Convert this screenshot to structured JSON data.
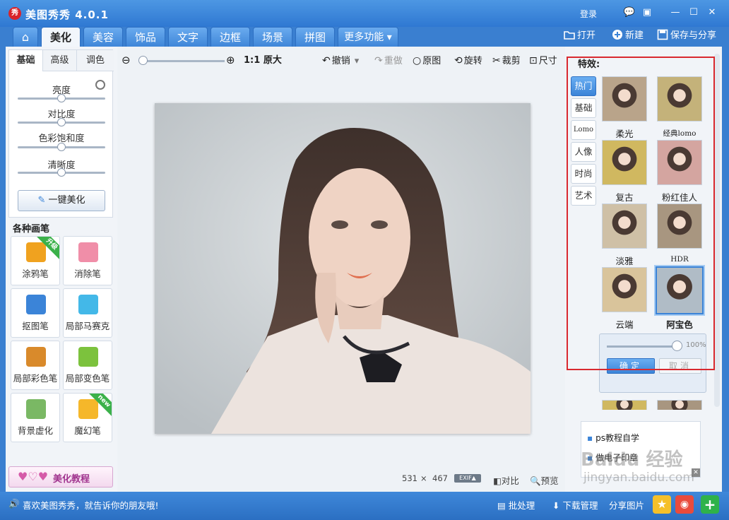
{
  "app": {
    "title": "美图秀秀 4.0.1",
    "logo_text": "秀",
    "login": "登录"
  },
  "window_controls": {
    "message": "💬",
    "skin": "▣",
    "minimize": "—",
    "maximize": "☐",
    "close": "✕"
  },
  "tabs": [
    {
      "label": "⌂"
    },
    {
      "label": "美化"
    },
    {
      "label": "美容"
    },
    {
      "label": "饰品"
    },
    {
      "label": "文字"
    },
    {
      "label": "边框"
    },
    {
      "label": "场景"
    },
    {
      "label": "拼图"
    },
    {
      "label": "更多功能 ▾"
    }
  ],
  "actions": {
    "open": "打开",
    "new": "新建",
    "save": "保存与分享"
  },
  "left": {
    "subtabs": [
      "基础",
      "高级",
      "调色"
    ],
    "sliders": [
      {
        "label": "亮度",
        "value": 0.5
      },
      {
        "label": "对比度",
        "value": 0.5
      },
      {
        "label": "色彩饱和度",
        "value": 0.5
      },
      {
        "label": "清晰度",
        "value": 0.5
      }
    ],
    "onekey": "一键美化",
    "brushes_title": "各种画笔",
    "brushes": [
      {
        "label": "涂鸦笔",
        "badge": "升级",
        "color": "#f0a21f"
      },
      {
        "label": "消除笔",
        "badge": "",
        "color": "#f08ea8"
      },
      {
        "label": "抠图笔",
        "badge": "",
        "color": "#3b84d8"
      },
      {
        "label": "局部马赛克",
        "badge": "",
        "color": "#43b8e8"
      },
      {
        "label": "局部彩色笔",
        "badge": "",
        "color": "#d98a2b"
      },
      {
        "label": "局部变色笔",
        "badge": "",
        "color": "#7cc23d"
      },
      {
        "label": "背景虚化",
        "badge": "",
        "color": "#7ab864"
      },
      {
        "label": "魔幻笔",
        "badge": "new",
        "color": "#f5b72a"
      }
    ],
    "tutorial": "美化教程"
  },
  "toolbar": {
    "zoom_value": 0.0,
    "actual_size": "1:1 原大",
    "undo": "撤销",
    "redo": "重做",
    "original": "原图",
    "rotate": "旋转",
    "crop": "裁剪",
    "size": "尺寸"
  },
  "status": {
    "width": "531",
    "times": "×",
    "height": "467",
    "exif": "EXIF▲",
    "compare": "对比",
    "preview": "预览"
  },
  "right": {
    "effects_label": "特效:",
    "categories": [
      "热门",
      "基础",
      "Lomo",
      "人像",
      "时尚",
      "艺术"
    ],
    "thumbs": [
      {
        "label": "柔光",
        "tone": "#b9a48a"
      },
      {
        "label": "经典lomo",
        "tone": "#c4b27a"
      },
      {
        "label": "复古",
        "tone": "#d0b860"
      },
      {
        "label": "粉红佳人",
        "tone": "#d4a5a0"
      },
      {
        "label": "淡雅",
        "tone": "#cfc0a6"
      },
      {
        "label": "HDR",
        "tone": "#a89680"
      },
      {
        "label": "云端",
        "tone": "#d9c49b"
      },
      {
        "label": "阿宝色",
        "tone": "#b0bcc6"
      }
    ],
    "intensity": {
      "value": 1.0,
      "text": "100%"
    },
    "ok": "确定",
    "cancel": "取消",
    "ad_items": [
      "ps教程自学",
      "做电子印章"
    ]
  },
  "watermark": {
    "logo": "Baidu 经验",
    "url": "jingyan.baidu.com"
  },
  "bottom": {
    "share_msg": "喜欢美图秀秀，就告诉你的朋友哦!",
    "batch": "批处理",
    "download": "下载管理",
    "share_pic": "分享图片"
  }
}
